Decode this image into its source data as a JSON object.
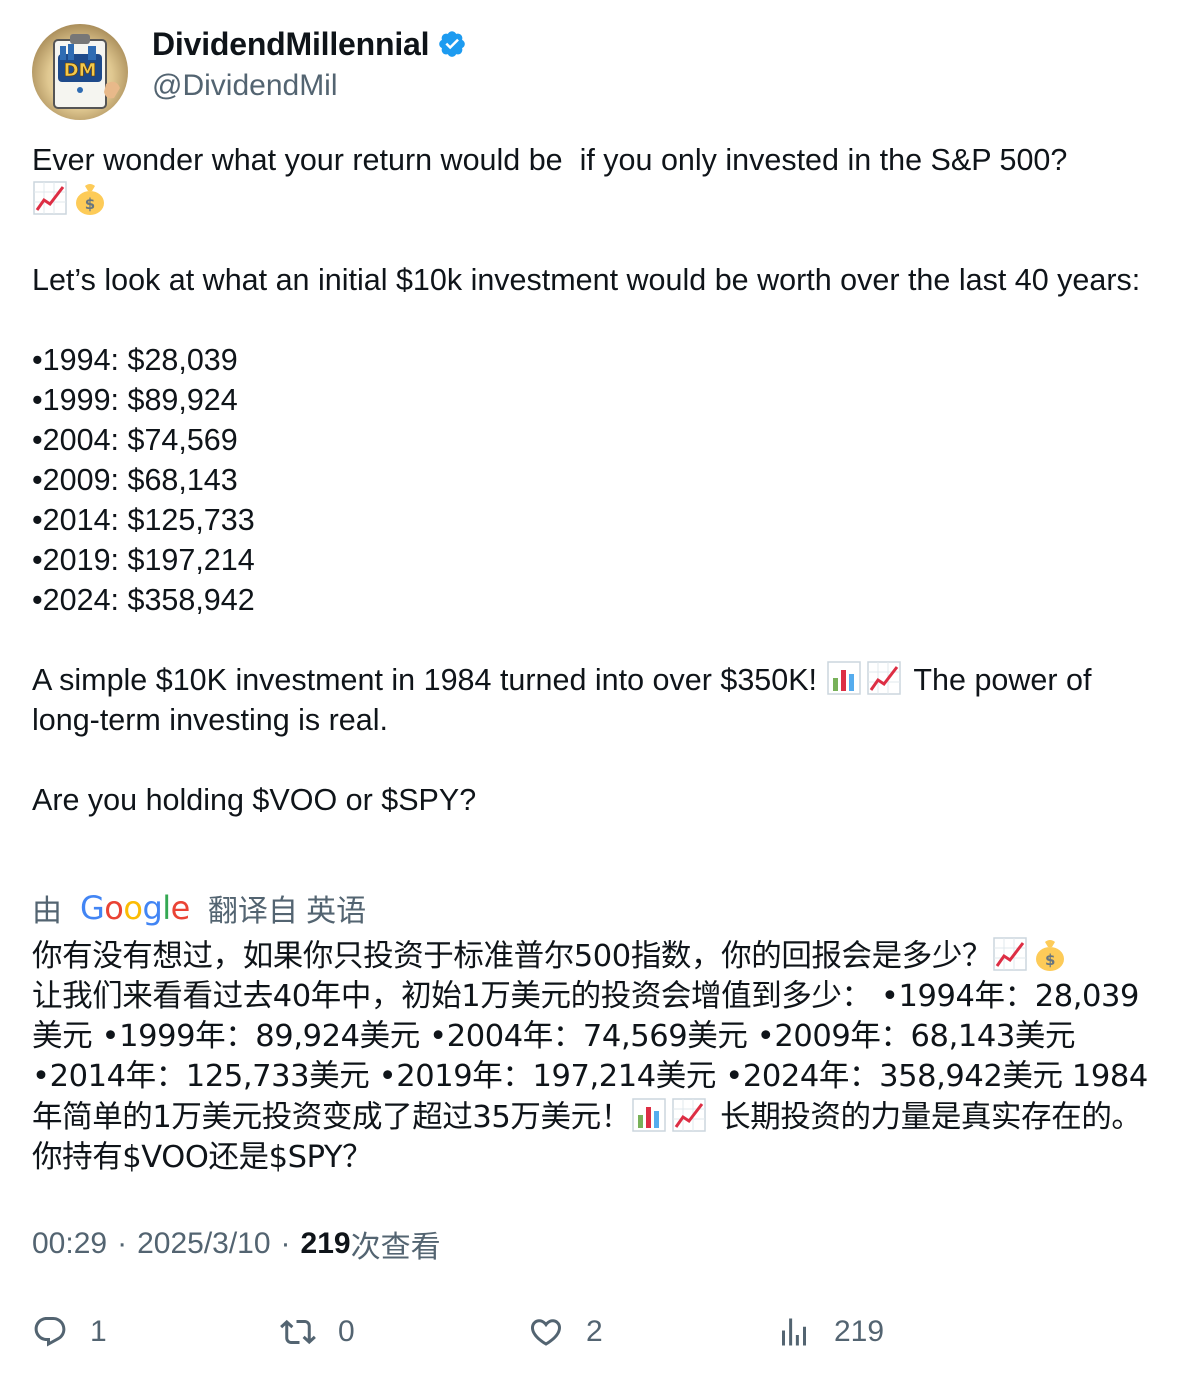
{
  "author": {
    "display_name": "DividendMillennial",
    "handle": "@DividendMil",
    "avatar_text": "DM",
    "verified_icon": "verified-badge-icon"
  },
  "tweet": {
    "line1": "Ever wonder what your return would be  if you only invested in the S&P 500?",
    "intro": "Let’s look at what an initial $10k investment would be worth over the last 40 years:",
    "bullets": [
      "•1994: $28,039",
      "•1999: $89,924",
      "•2004: $74,569",
      "•2009: $68,143",
      "•2014: $125,733",
      "•2019: $197,214",
      "•2024: $358,942"
    ],
    "conclusion_a": "A simple $10K investment in 1984 turned into over $350K! ",
    "conclusion_b": " The power of long-term investing is real.",
    "question": "Are you holding $VOO or $SPY?"
  },
  "translation": {
    "prefix": "由",
    "google": [
      "G",
      "o",
      "o",
      "g",
      "l",
      "e"
    ],
    "suffix": "翻译自 英语",
    "part1": "你有没有想过，如果你只投资于标准普尔500指数，你的回报会是多少？",
    "part2": "让我们来看看过去40年中，初始1万美元的投资会增值到多少： •1994年：28,039美元 •1999年：89,924美元 •2004年：74,569美元 •2009年：68,143美元 •2014年：125,733美元 •2019年：197,214美元 •2024年：358,942美元 1984年简单的1万美元投资变成了超过35万美元！",
    "part3": " 长期投资的力量是真实存在的。 你持有$VOO还是$SPY？"
  },
  "meta": {
    "time": "00:29",
    "date": "2025/3/10",
    "views_count": "219",
    "views_label": "次查看"
  },
  "actions": {
    "replies": "1",
    "retweets": "0",
    "likes": "2",
    "views": "219"
  },
  "colors": {
    "text": "#0f1419",
    "secondary": "#536471",
    "verified": "#1d9bf0"
  }
}
